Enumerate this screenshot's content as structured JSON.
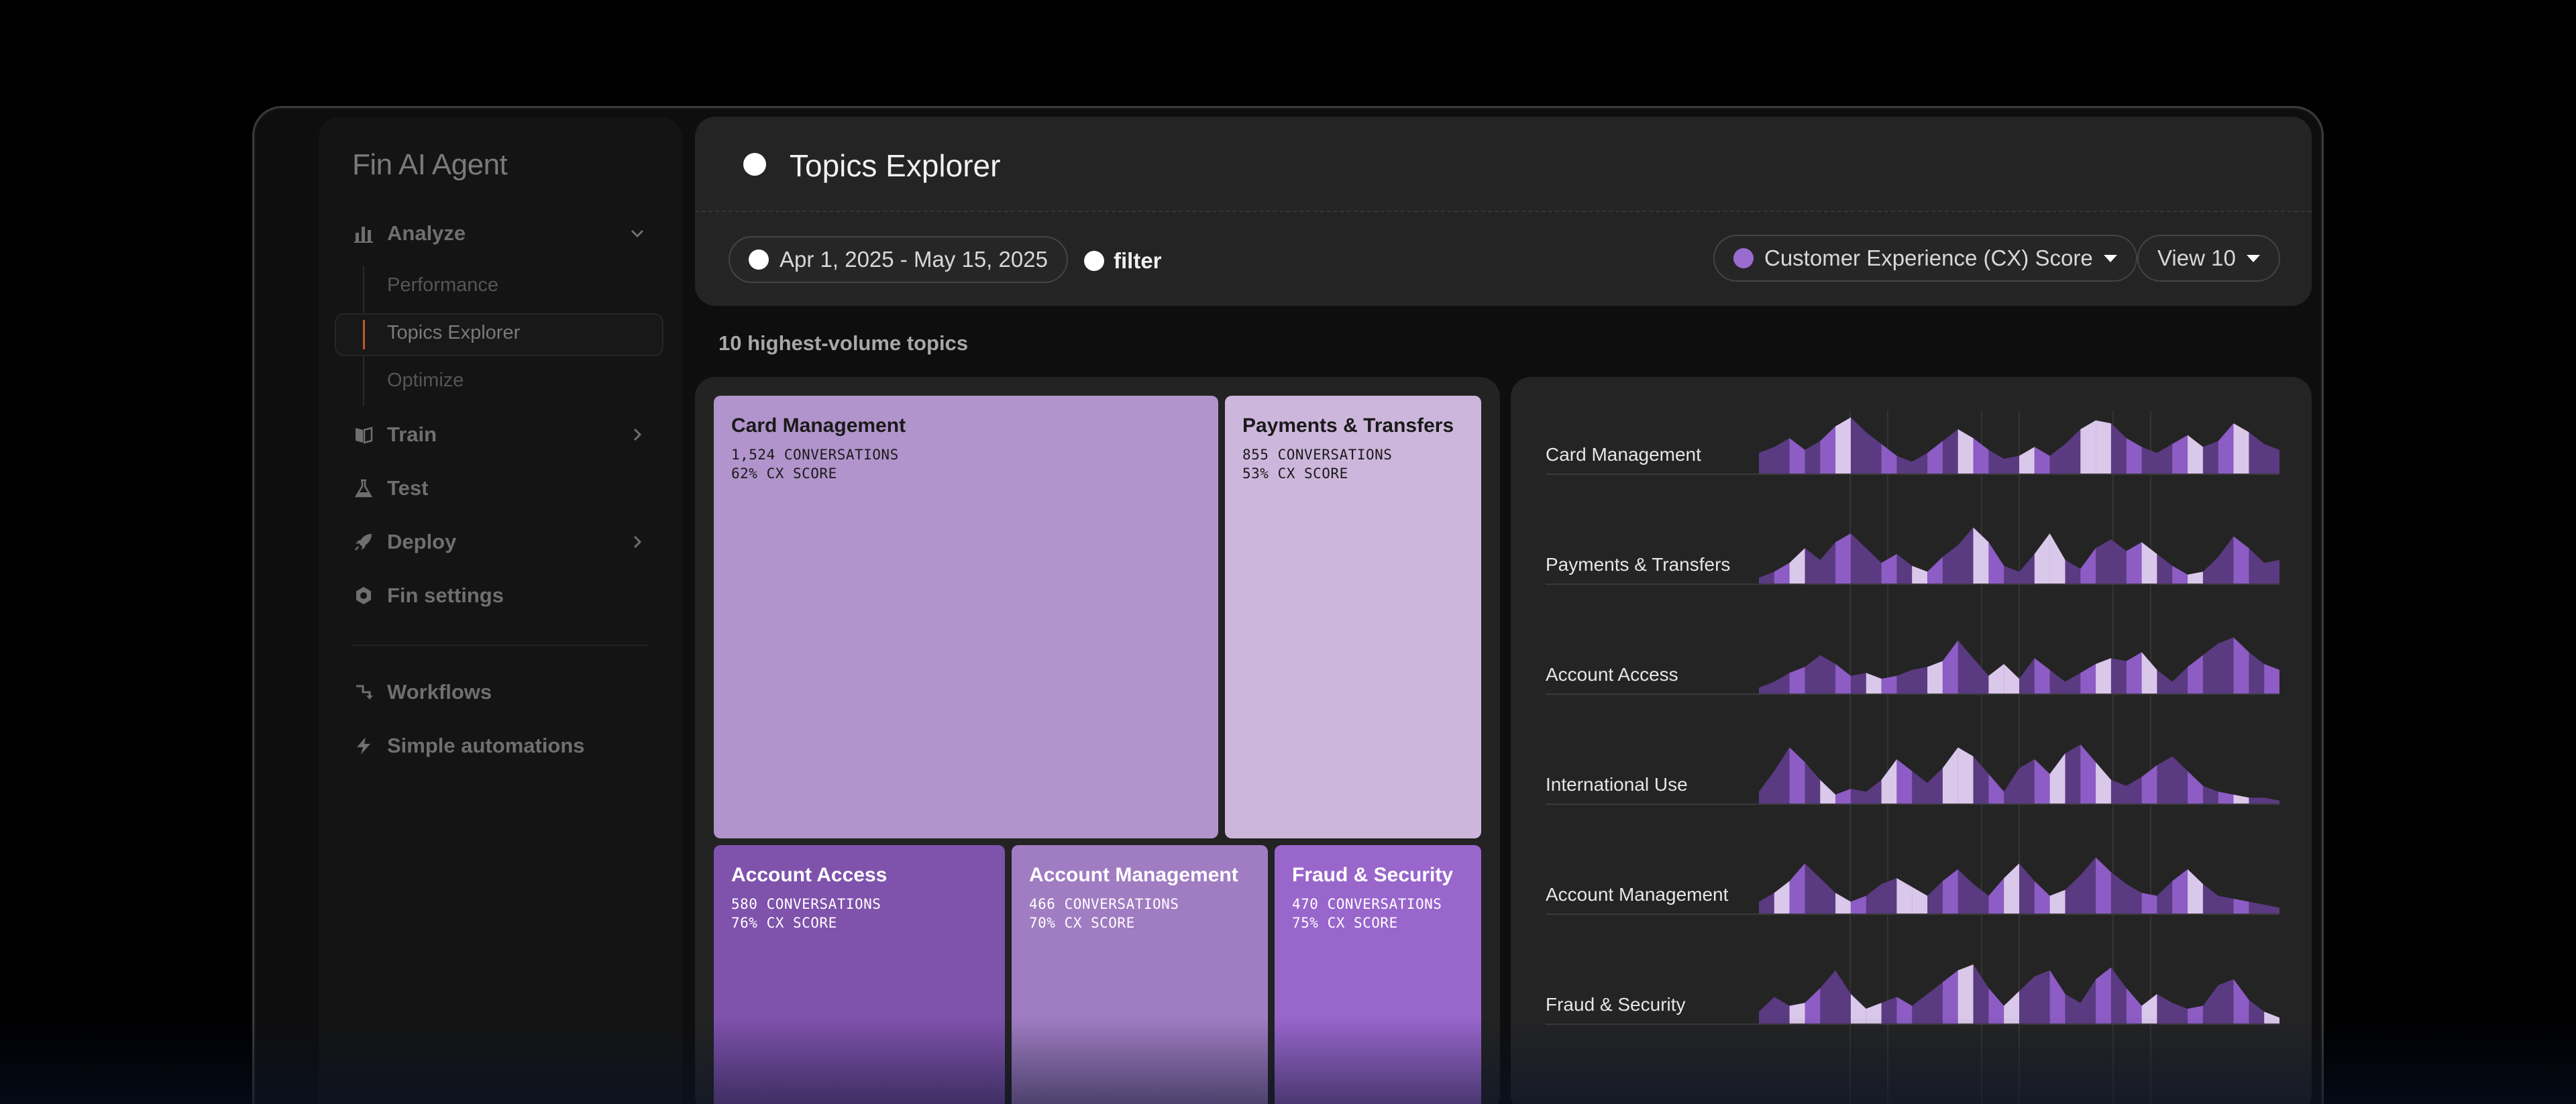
{
  "sidebar": {
    "app_title": "Fin AI Agent",
    "items": [
      {
        "label": "Analyze",
        "icon": "bar-chart-icon",
        "expanded": true
      },
      {
        "label": "Train",
        "icon": "book-icon"
      },
      {
        "label": "Test",
        "icon": "flask-icon"
      },
      {
        "label": "Deploy",
        "icon": "rocket-icon"
      },
      {
        "label": "Fin settings",
        "icon": "gear-icon"
      },
      {
        "label": "Workflows",
        "icon": "workflow-icon"
      },
      {
        "label": "Simple automations",
        "icon": "bolt-icon"
      }
    ],
    "sub_items": [
      {
        "label": "Performance"
      },
      {
        "label": "Topics Explorer",
        "active": true
      },
      {
        "label": "Optimize"
      }
    ]
  },
  "header": {
    "title": "Topics Explorer",
    "date_range": "Apr 1, 2025 - May 15, 2025",
    "filter_label": "filter",
    "metric_select": "Customer Experience (CX) Score",
    "view_select": "View 10"
  },
  "section_label": "10 highest-volume topics",
  "colors": {
    "accent_purple": "#9a6cd0",
    "tile_card": "#b194cb",
    "tile_payments": "#cdb6dc",
    "tile_account_access": "#7f52ac",
    "tile_account_mgmt": "#a07cc2",
    "tile_fraud": "#9966cc",
    "spark_dark": "#5a3a80",
    "spark_mid": "#8d5cc4",
    "spark_light": "#dac8ea"
  },
  "treemap": [
    {
      "name": "Card Management",
      "conversations": "1,524 CONVERSATIONS",
      "score": "62% CX SCORE"
    },
    {
      "name": "Payments & Transfers",
      "conversations": "855 CONVERSATIONS",
      "score": "53% CX SCORE"
    },
    {
      "name": "Account Access",
      "conversations": "580 CONVERSATIONS",
      "score": "76% CX SCORE"
    },
    {
      "name": "Account Management",
      "conversations": "466 CONVERSATIONS",
      "score": "70% CX SCORE"
    },
    {
      "name": "Fraud & Security",
      "conversations": "470 CONVERSATIONS",
      "score": "75% CX SCORE"
    }
  ],
  "sparklines": [
    {
      "label": "Card Management",
      "values": [
        0.35,
        0.45,
        0.6,
        0.4,
        0.55,
        0.8,
        0.95,
        0.7,
        0.5,
        0.3,
        0.2,
        0.35,
        0.55,
        0.75,
        0.6,
        0.4,
        0.25,
        0.3,
        0.45,
        0.3,
        0.5,
        0.75,
        0.9,
        0.85,
        0.6,
        0.45,
        0.35,
        0.5,
        0.65,
        0.45,
        0.55,
        0.85,
        0.7,
        0.5,
        0.4
      ]
    },
    {
      "label": "Payments & Transfers",
      "values": [
        0.1,
        0.2,
        0.35,
        0.6,
        0.4,
        0.7,
        0.85,
        0.6,
        0.35,
        0.5,
        0.3,
        0.2,
        0.45,
        0.65,
        0.95,
        0.7,
        0.3,
        0.2,
        0.5,
        0.85,
        0.4,
        0.25,
        0.6,
        0.75,
        0.55,
        0.7,
        0.5,
        0.3,
        0.15,
        0.2,
        0.45,
        0.8,
        0.6,
        0.35,
        0.4
      ]
    },
    {
      "label": "Account Access",
      "values": [
        0.1,
        0.2,
        0.35,
        0.45,
        0.65,
        0.5,
        0.3,
        0.35,
        0.25,
        0.3,
        0.4,
        0.45,
        0.55,
        0.9,
        0.6,
        0.3,
        0.5,
        0.25,
        0.6,
        0.4,
        0.2,
        0.35,
        0.5,
        0.6,
        0.55,
        0.7,
        0.4,
        0.2,
        0.45,
        0.65,
        0.85,
        0.95,
        0.7,
        0.5,
        0.4
      ]
    },
    {
      "label": "International Use",
      "values": [
        0.2,
        0.55,
        0.95,
        0.7,
        0.4,
        0.15,
        0.25,
        0.2,
        0.4,
        0.75,
        0.55,
        0.35,
        0.6,
        0.95,
        0.8,
        0.5,
        0.2,
        0.6,
        0.75,
        0.5,
        0.85,
        1.0,
        0.7,
        0.4,
        0.3,
        0.45,
        0.65,
        0.8,
        0.55,
        0.3,
        0.2,
        0.15,
        0.1,
        0.1,
        0.05
      ]
    },
    {
      "label": "Account Management",
      "values": [
        0.2,
        0.35,
        0.55,
        0.85,
        0.6,
        0.35,
        0.2,
        0.3,
        0.5,
        0.6,
        0.45,
        0.3,
        0.55,
        0.75,
        0.5,
        0.3,
        0.6,
        0.85,
        0.55,
        0.3,
        0.4,
        0.65,
        0.95,
        0.7,
        0.5,
        0.35,
        0.3,
        0.55,
        0.75,
        0.5,
        0.3,
        0.25,
        0.2,
        0.15,
        0.1
      ]
    },
    {
      "label": "Fraud & Security",
      "values": [
        0.2,
        0.45,
        0.3,
        0.35,
        0.6,
        0.9,
        0.5,
        0.25,
        0.35,
        0.45,
        0.3,
        0.5,
        0.7,
        0.9,
        1.0,
        0.6,
        0.3,
        0.55,
        0.8,
        0.9,
        0.5,
        0.35,
        0.75,
        0.95,
        0.6,
        0.3,
        0.5,
        0.35,
        0.25,
        0.3,
        0.65,
        0.75,
        0.4,
        0.2,
        0.1
      ]
    }
  ]
}
